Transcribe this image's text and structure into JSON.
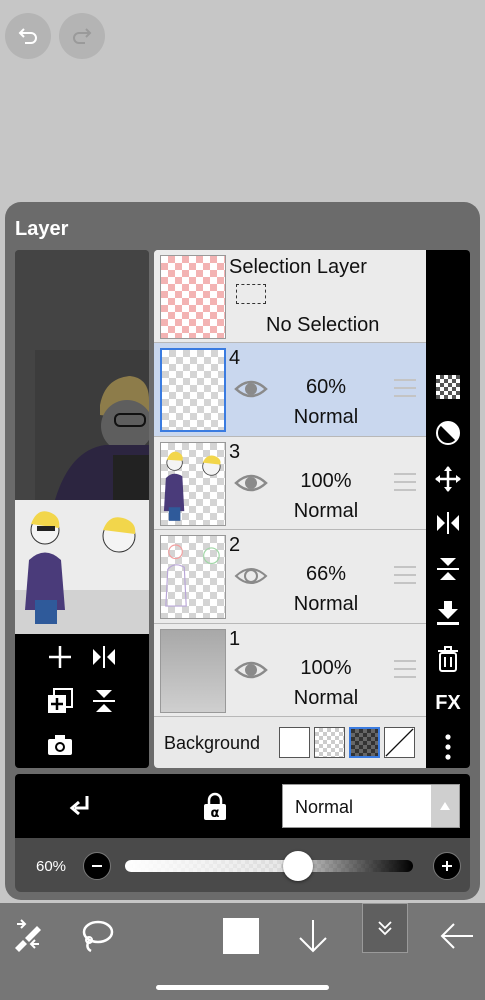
{
  "panel": {
    "title": "Layer"
  },
  "selection_layer": {
    "name": "Selection Layer",
    "status": "No Selection"
  },
  "layers": [
    {
      "number": "4",
      "opacity": "60%",
      "blend": "Normal",
      "selected": true
    },
    {
      "number": "3",
      "opacity": "100%",
      "blend": "Normal",
      "selected": false
    },
    {
      "number": "2",
      "opacity": "66%",
      "blend": "Normal",
      "selected": false
    },
    {
      "number": "1",
      "opacity": "100%",
      "blend": "Normal",
      "selected": false
    }
  ],
  "background": {
    "label": "Background",
    "options": [
      "white",
      "transparent",
      "dark-checker",
      "none"
    ],
    "selected": "dark-checker"
  },
  "blend_mode": {
    "value": "Normal"
  },
  "opacity_slider": {
    "label": "60%",
    "value": 0.6
  },
  "side_tools": [
    "checker-icon",
    "contrast-icon",
    "move-icon",
    "flip-horizontal-icon",
    "flip-vertical-icon",
    "merge-down-icon",
    "trash-icon",
    "fx-button",
    "more-icon"
  ],
  "side_tools_fx_label": "FX",
  "colors": {
    "accent": "#3a7be0",
    "selected_row": "#c9d7ee",
    "panel": "#6b6b6b"
  }
}
